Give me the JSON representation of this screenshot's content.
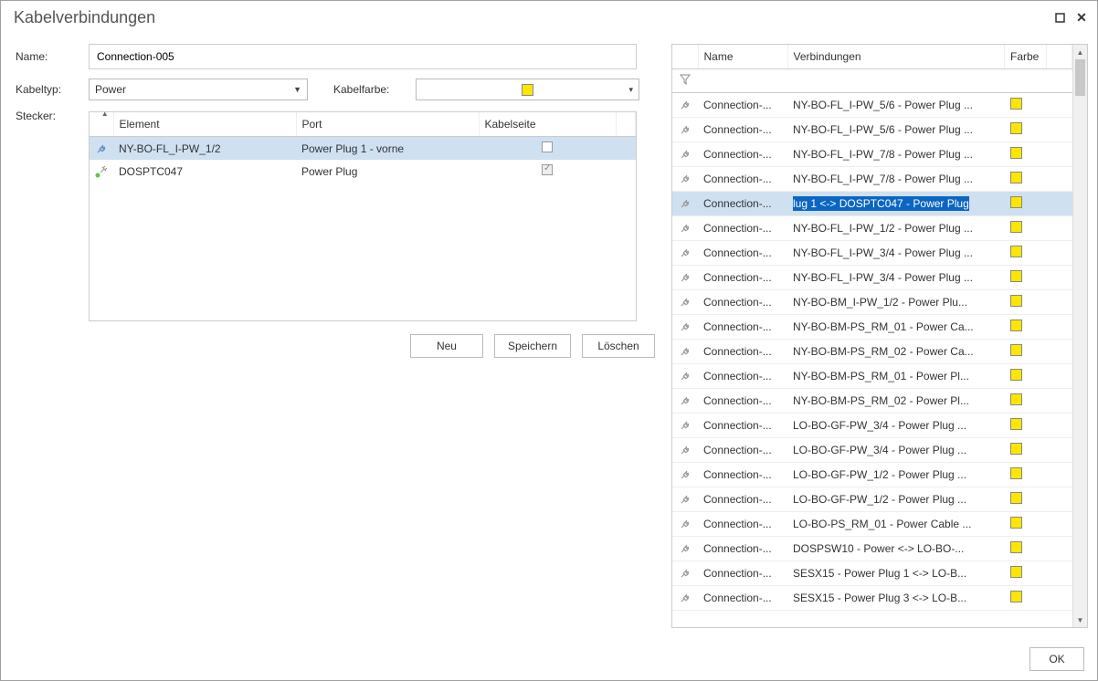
{
  "window": {
    "title": "Kabelverbindungen"
  },
  "form": {
    "name_label": "Name:",
    "name_value": "Connection-005",
    "type_label": "Kabeltyp:",
    "type_value": "Power",
    "color_label": "Kabelfarbe:",
    "plug_label": "Stecker:"
  },
  "plug_headers": {
    "element": "Element",
    "port": "Port",
    "side": "Kabelseite"
  },
  "plug_rows": [
    {
      "element": "NY-BO-FL_I-PW_1/2",
      "port": "Power Plug 1 - vorne",
      "checked": false,
      "selected": true,
      "icon": "blue"
    },
    {
      "element": "DOSPTC047",
      "port": "Power Plug",
      "checked": true,
      "selected": false,
      "icon": "green"
    }
  ],
  "buttons": {
    "neu": "Neu",
    "speichern": "Speichern",
    "loeschen": "Löschen",
    "ok": "OK"
  },
  "conn_headers": {
    "name": "Name",
    "verb": "Verbindungen",
    "farbe": "Farbe"
  },
  "conn_rows": [
    {
      "name": "Connection-...",
      "verb": "NY-BO-FL_I-PW_5/6 - Power Plug ...",
      "sel": false
    },
    {
      "name": "Connection-...",
      "verb": "NY-BO-FL_I-PW_5/6 - Power Plug ...",
      "sel": false
    },
    {
      "name": "Connection-...",
      "verb": "NY-BO-FL_I-PW_7/8 - Power Plug ...",
      "sel": false
    },
    {
      "name": "Connection-...",
      "verb": "NY-BO-FL_I-PW_7/8 - Power Plug ...",
      "sel": false
    },
    {
      "name": "Connection-...",
      "verb": "lug 1 <-> DOSPTC047 - Power Plug",
      "sel": true
    },
    {
      "name": "Connection-...",
      "verb": "NY-BO-FL_I-PW_1/2 - Power Plug ...",
      "sel": false
    },
    {
      "name": "Connection-...",
      "verb": "NY-BO-FL_I-PW_3/4 - Power Plug ...",
      "sel": false
    },
    {
      "name": "Connection-...",
      "verb": "NY-BO-FL_I-PW_3/4 - Power Plug ...",
      "sel": false
    },
    {
      "name": "Connection-...",
      "verb": "NY-BO-BM_I-PW_1/2 - Power Plu...",
      "sel": false
    },
    {
      "name": "Connection-...",
      "verb": "NY-BO-BM-PS_RM_01 - Power Ca...",
      "sel": false
    },
    {
      "name": "Connection-...",
      "verb": "NY-BO-BM-PS_RM_02 - Power Ca...",
      "sel": false
    },
    {
      "name": "Connection-...",
      "verb": "NY-BO-BM-PS_RM_01 - Power Pl...",
      "sel": false
    },
    {
      "name": "Connection-...",
      "verb": "NY-BO-BM-PS_RM_02 - Power Pl...",
      "sel": false
    },
    {
      "name": "Connection-...",
      "verb": "LO-BO-GF-PW_3/4 - Power Plug ...",
      "sel": false
    },
    {
      "name": "Connection-...",
      "verb": "LO-BO-GF-PW_3/4 - Power Plug ...",
      "sel": false
    },
    {
      "name": "Connection-...",
      "verb": "LO-BO-GF-PW_1/2 - Power Plug ...",
      "sel": false
    },
    {
      "name": "Connection-...",
      "verb": "LO-BO-GF-PW_1/2 - Power Plug ...",
      "sel": false
    },
    {
      "name": "Connection-...",
      "verb": "LO-BO-PS_RM_01 - Power Cable ...",
      "sel": false
    },
    {
      "name": "Connection-...",
      "verb": "DOSPSW10 - Power <-> LO-BO-...",
      "sel": false
    },
    {
      "name": "Connection-...",
      "verb": "SESX15 - Power Plug 1 <-> LO-B...",
      "sel": false
    },
    {
      "name": "Connection-...",
      "verb": "SESX15 - Power Plug 3 <-> LO-B...",
      "sel": false
    }
  ],
  "colors": {
    "yellow": "#ffe600"
  }
}
